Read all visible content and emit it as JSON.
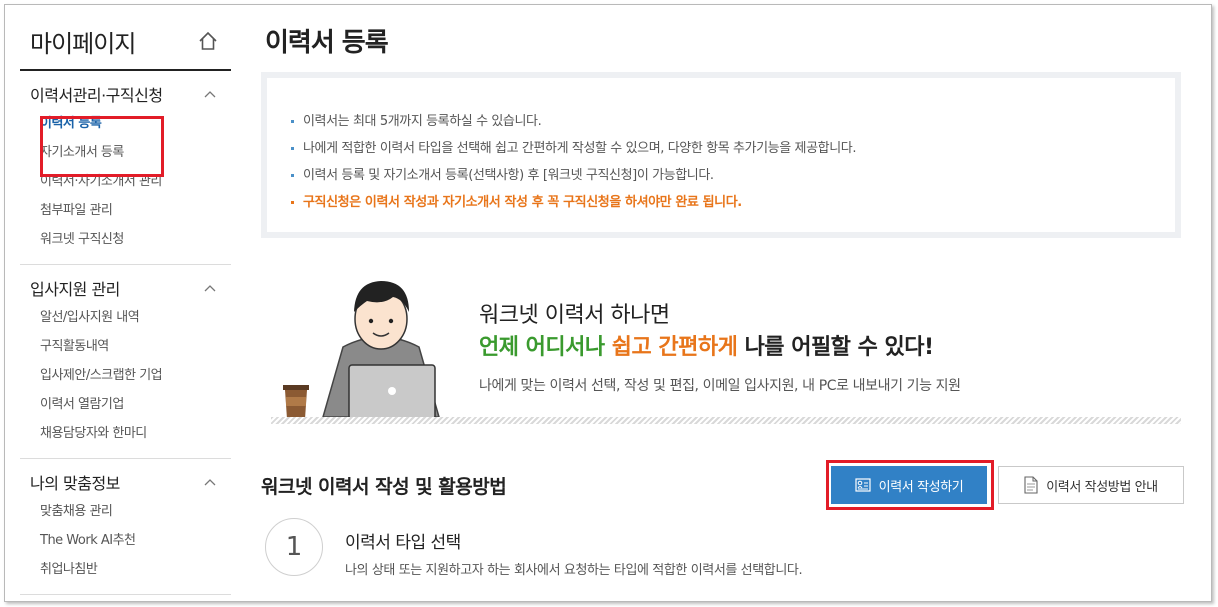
{
  "sidebar": {
    "title": "마이페이지",
    "groups": [
      {
        "title": "이력서관리·구직신청",
        "items": [
          {
            "label": "이력서 등록"
          },
          {
            "label": "자기소개서 등록"
          },
          {
            "label": "이력서·자기소개서 관리"
          },
          {
            "label": "첨부파일 관리"
          },
          {
            "label": "워크넷 구직신청"
          }
        ]
      },
      {
        "title": "입사지원 관리",
        "items": [
          {
            "label": "알선/입사지원 내역"
          },
          {
            "label": "구직활동내역"
          },
          {
            "label": "입사제안/스크랩한 기업"
          },
          {
            "label": "이력서 열람기업"
          },
          {
            "label": "채용담당자와 한마디"
          }
        ]
      },
      {
        "title": "나의 맞춤정보",
        "items": [
          {
            "label": "맞춤채용 관리"
          },
          {
            "label": "The Work AI추천"
          },
          {
            "label": "취업나침반"
          }
        ]
      }
    ]
  },
  "main": {
    "title": "이력서 등록",
    "notices": [
      "이력서는 최대 5개까지 등록하실 수 있습니다.",
      "나에게 적합한 이력서 타입을 선택해 쉽고 간편하게 작성할 수 있으며, 다양한 항목 추가기능을 제공합니다.",
      "이력서 등록 및 자기소개서 등록(선택사항) 후 [워크넷 구직신청]이 가능합니다.",
      "구직신청은 이력서 작성과 자기소개서 작성 후 꼭 구직신청을 하셔야만 완료 됩니다."
    ],
    "promo": {
      "line1": "워크넷 이력서 하나면",
      "line2_green": "언제 어디서나",
      "line2_orange": "쉽고 간편하게",
      "line2_rest": "나를 어필할 수 있다!",
      "sub": "나에게 맞는 이력서 선택, 작성 및 편집, 이메일 입사지원, 내 PC로 내보내기 기능 지원"
    },
    "howto": {
      "title": "워크넷 이력서 작성 및 활용방법",
      "write_button": "이력서 작성하기",
      "guide_button": "이력서 작성방법 안내"
    },
    "step1": {
      "number": "1",
      "title": "이력서 타입 선택",
      "desc": "나의 상태 또는 지원하고자 하는 회사에서 요청하는 타입에 적합한 이력서를 선택합니다."
    }
  },
  "colors": {
    "accent_blue": "#3181c6",
    "highlight_red": "#e21c28",
    "green": "#3a9a2e",
    "orange": "#e8751a"
  },
  "icons": [
    "home-icon",
    "chevron-up-icon",
    "resume-icon",
    "document-icon"
  ]
}
